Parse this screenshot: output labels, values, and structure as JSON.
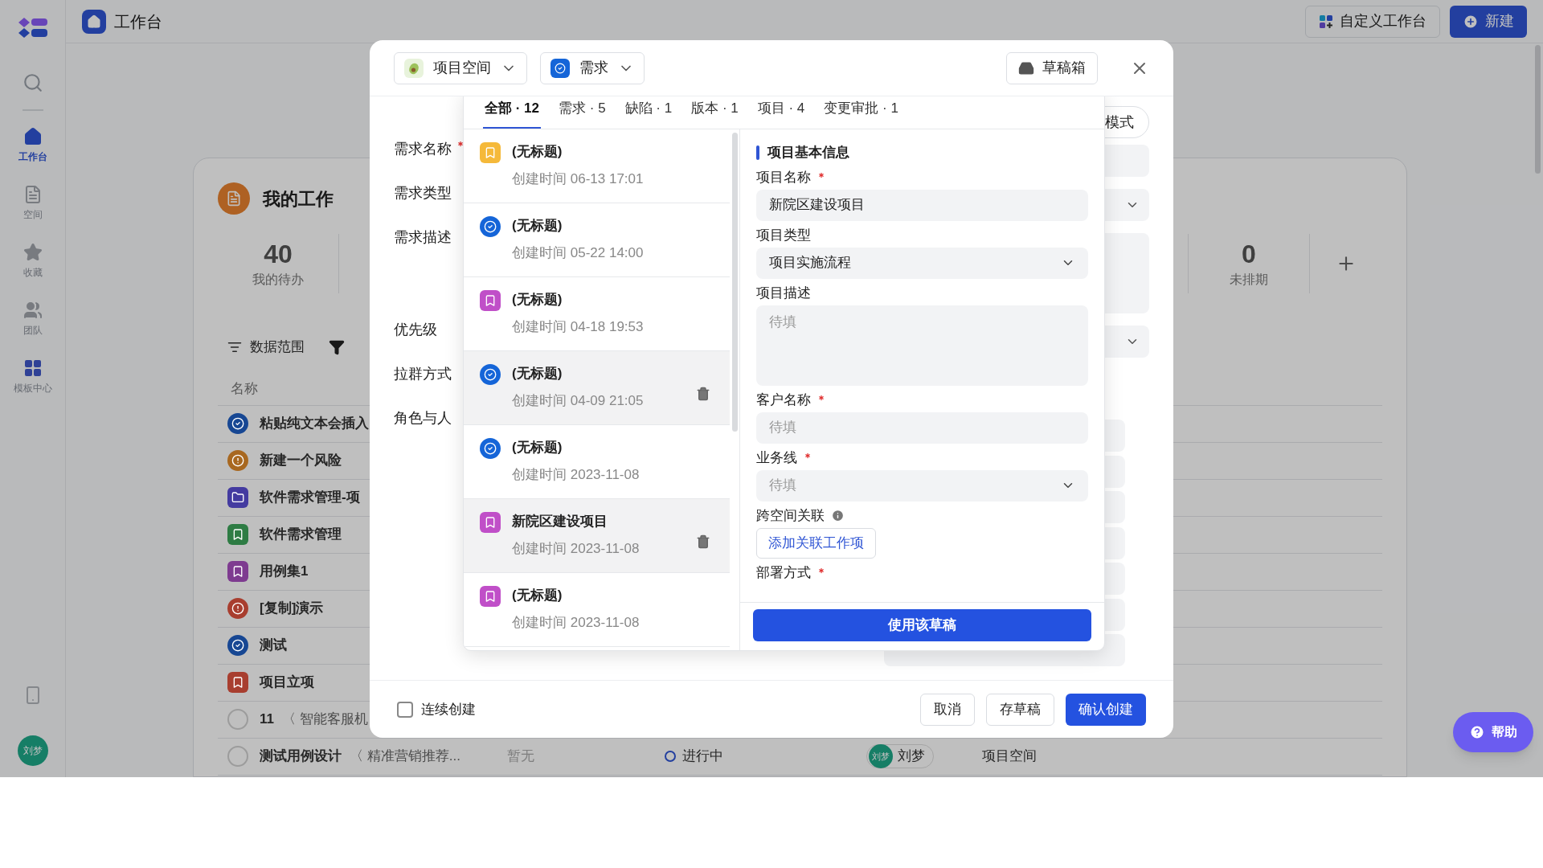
{
  "sidebar": {
    "items": [
      {
        "label": "工作台",
        "kind": "home",
        "selected": true
      },
      {
        "label": "空间",
        "kind": "space",
        "selected": false
      },
      {
        "label": "收藏",
        "kind": "star",
        "selected": false
      },
      {
        "label": "团队",
        "kind": "team",
        "selected": false
      },
      {
        "label": "模板中心",
        "kind": "template",
        "selected": false
      }
    ],
    "avatar": "刘梦"
  },
  "header": {
    "title": "工作台",
    "buttons": [
      {
        "label": "自定义工作台",
        "kind": "secondary"
      },
      {
        "label": "新建",
        "kind": "primary"
      }
    ]
  },
  "my_work": {
    "title": "我的工作",
    "stats": [
      {
        "value": "40",
        "label": "我的待办"
      },
      {
        "value": "0",
        "label": "未排期"
      }
    ],
    "toolbar": [
      "数据范围"
    ],
    "columns": [
      "名称"
    ],
    "rows": [
      {
        "name": "粘贴纯文本会插入",
        "kind": "check",
        "color": "#174793"
      },
      {
        "name": "新建一个风险",
        "kind": "alert",
        "color": "#a86820"
      },
      {
        "name": "软件需求管理-项",
        "kind": "folder",
        "color": "#443ba0"
      },
      {
        "name": "软件需求管理",
        "kind": "bookmark",
        "color": "#2e7c44"
      },
      {
        "name": "用例集1",
        "kind": "bookmark",
        "color": "#7e3b90"
      },
      {
        "name": "[复制]演示",
        "kind": "alert",
        "color": "#a83e2f"
      },
      {
        "name": "测试",
        "kind": "check",
        "color": "#174793"
      },
      {
        "name": "项目立项",
        "kind": "bookmark",
        "color": "#a83e2f"
      },
      {
        "name": "11",
        "parent": "〈 智能客服机",
        "kind": "circle",
        "color": "#9c9c9c"
      },
      {
        "name": "测试用例设计",
        "parent": "〈 精准营销推荐...",
        "kind": "circle",
        "color": "#9c9c9c",
        "estimate": "暂无",
        "status": "进行中",
        "avatar": "刘梦",
        "assignee": "刘梦",
        "space": "项目空间"
      }
    ]
  },
  "modal": {
    "space": "项目空间",
    "type": "需求",
    "drafts_button": "草稿箱",
    "mode_button": "模式",
    "form_labels": [
      {
        "label": "需求名称",
        "required": true
      },
      {
        "label": "需求类型",
        "required": false
      },
      {
        "label": "需求描述",
        "required": false
      },
      {
        "label": "优先级",
        "required": false
      },
      {
        "label": "拉群方式",
        "required": false
      },
      {
        "label": "角色与人",
        "required": false
      }
    ],
    "continuous": {
      "label": "连续创建",
      "checked": false
    },
    "buttons": [
      {
        "label": "取消",
        "kind": "secondary"
      },
      {
        "label": "存草稿",
        "kind": "secondary"
      },
      {
        "label": "确认创建",
        "kind": "primary"
      }
    ]
  },
  "drafts": {
    "tabs": [
      {
        "label": "全部 · 12",
        "selected": true
      },
      {
        "label": "需求 · 5",
        "selected": false
      },
      {
        "label": "缺陷 · 1",
        "selected": false
      },
      {
        "label": "版本 · 1",
        "selected": false
      },
      {
        "label": "项目 · 4",
        "selected": false
      },
      {
        "label": "变更审批 · 1",
        "selected": false
      }
    ],
    "items": [
      {
        "title": "(无标题)",
        "time": "创建时间 06-13 17:01",
        "kind": "bookmark",
        "color": "#f5b93a",
        "selected": false
      },
      {
        "title": "(无标题)",
        "time": "创建时间 05-22 14:00",
        "kind": "check",
        "color": "#1565d8",
        "selected": false
      },
      {
        "title": "(无标题)",
        "time": "创建时间 04-18 19:53",
        "kind": "bookmark",
        "color": "#c04fc8",
        "selected": false
      },
      {
        "title": "(无标题)",
        "time": "创建时间 04-09 21:05",
        "kind": "check",
        "color": "#1565d8",
        "selected": true
      },
      {
        "title": "(无标题)",
        "time": "创建时间 2023-11-08",
        "kind": "check",
        "color": "#1565d8",
        "selected": false
      },
      {
        "title": "新院区建设项目",
        "time": "创建时间 2023-11-08",
        "kind": "bookmark",
        "color": "#c04fc8",
        "selected": true
      },
      {
        "title": "(无标题)",
        "time": "创建时间 2023-11-08",
        "kind": "bookmark",
        "color": "#c04fc8",
        "selected": false
      }
    ],
    "preview": {
      "section": "项目基本信息",
      "fields": [
        {
          "label": "项目名称",
          "required": true,
          "kind": "text",
          "value": "新院区建设项目"
        },
        {
          "label": "项目类型",
          "required": false,
          "kind": "select",
          "value": "项目实施流程"
        },
        {
          "label": "项目描述",
          "required": false,
          "kind": "textarea",
          "placeholder": "待填"
        },
        {
          "label": "客户名称",
          "required": true,
          "kind": "text",
          "placeholder": "待填"
        },
        {
          "label": "业务线",
          "required": true,
          "kind": "select",
          "placeholder": "待填"
        },
        {
          "label": "跨空间关联",
          "required": false,
          "kind": "link",
          "info": true,
          "button": "添加关联工作项"
        },
        {
          "label": "部署方式",
          "required": true,
          "kind": "label"
        }
      ],
      "use_button": "使用该草稿"
    }
  },
  "help": "帮助"
}
